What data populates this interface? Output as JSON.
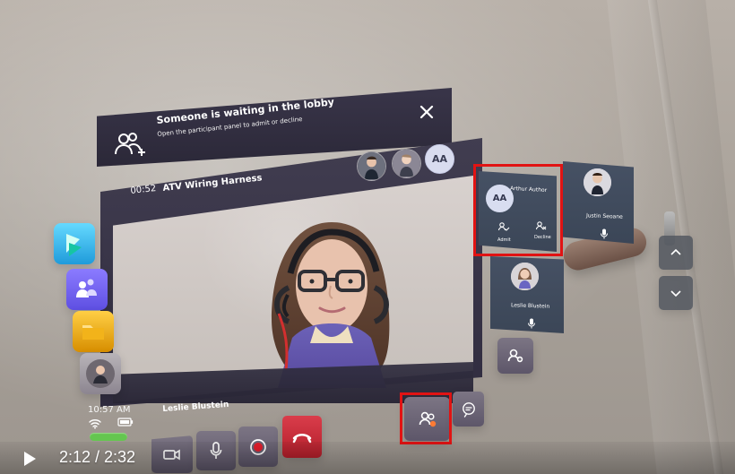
{
  "lobby_notification": {
    "title": "Someone is waiting in the lobby",
    "subtitle": "Open the participant panel to admit or decline"
  },
  "meeting": {
    "timer": "00:52",
    "title": "ATV Wiring Harness",
    "speaker_name": "Leslie Blustein",
    "top_avatars": [
      {
        "initials": ""
      },
      {
        "initials": ""
      },
      {
        "initials": "AA"
      }
    ]
  },
  "status_bar": {
    "time": "10:57 AM"
  },
  "participant_cards": {
    "waiting": {
      "initials": "AA",
      "name": "Arthur Author",
      "admit_label": "Admit",
      "decline_label": "Decline"
    },
    "justin": {
      "name": "Justin Seoane"
    },
    "leslie": {
      "name": "Leslie Blustein"
    }
  },
  "player": {
    "time": "2:12 / 2:32"
  }
}
